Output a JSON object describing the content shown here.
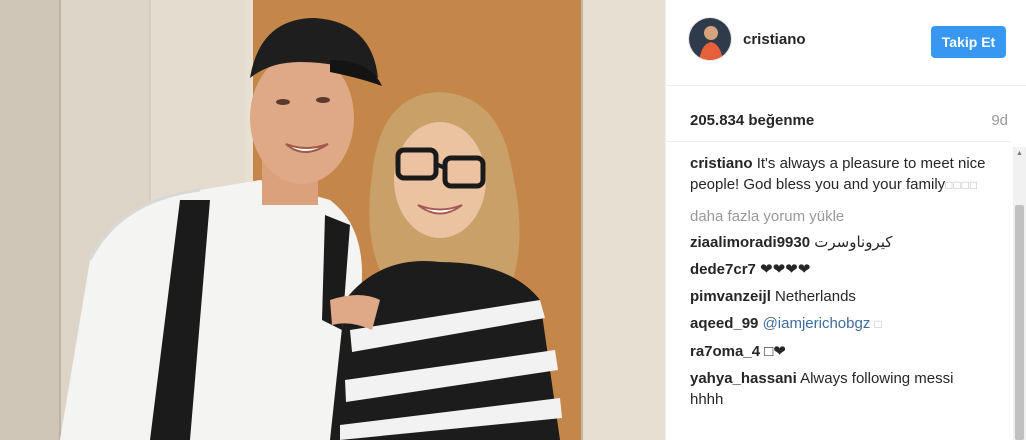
{
  "post": {
    "photo_alt": "",
    "author": "cristiano",
    "follow_label": "Takip Et",
    "likes": "205.834 beğenme",
    "age": "9d"
  },
  "caption": {
    "user": "cristiano",
    "text": "It's always a pleasure to meet nice people! God bless you and your family",
    "trailing": "□□□□"
  },
  "load_more": "daha fazla yorum yükle",
  "comments": [
    {
      "user": "ziaalimoradi9930",
      "text": "كيروناوسرت"
    },
    {
      "user": "dede7cr7",
      "text": "❤❤❤❤"
    },
    {
      "user": "pimvanzeijl",
      "text": "Netherlands"
    },
    {
      "user": "aqeed_99",
      "mention": "@iamjerichobgz",
      "text": "□"
    },
    {
      "user": "ra7oma_4",
      "text": "□❤"
    },
    {
      "user": "yahya_hassani",
      "text": "Always following messi hhhh"
    }
  ],
  "colors": {
    "follow_button": "#3897f0",
    "mention": "#3d6c9e",
    "muted": "#999999"
  },
  "icons": {
    "scroll_up": "triangle-up-icon"
  }
}
